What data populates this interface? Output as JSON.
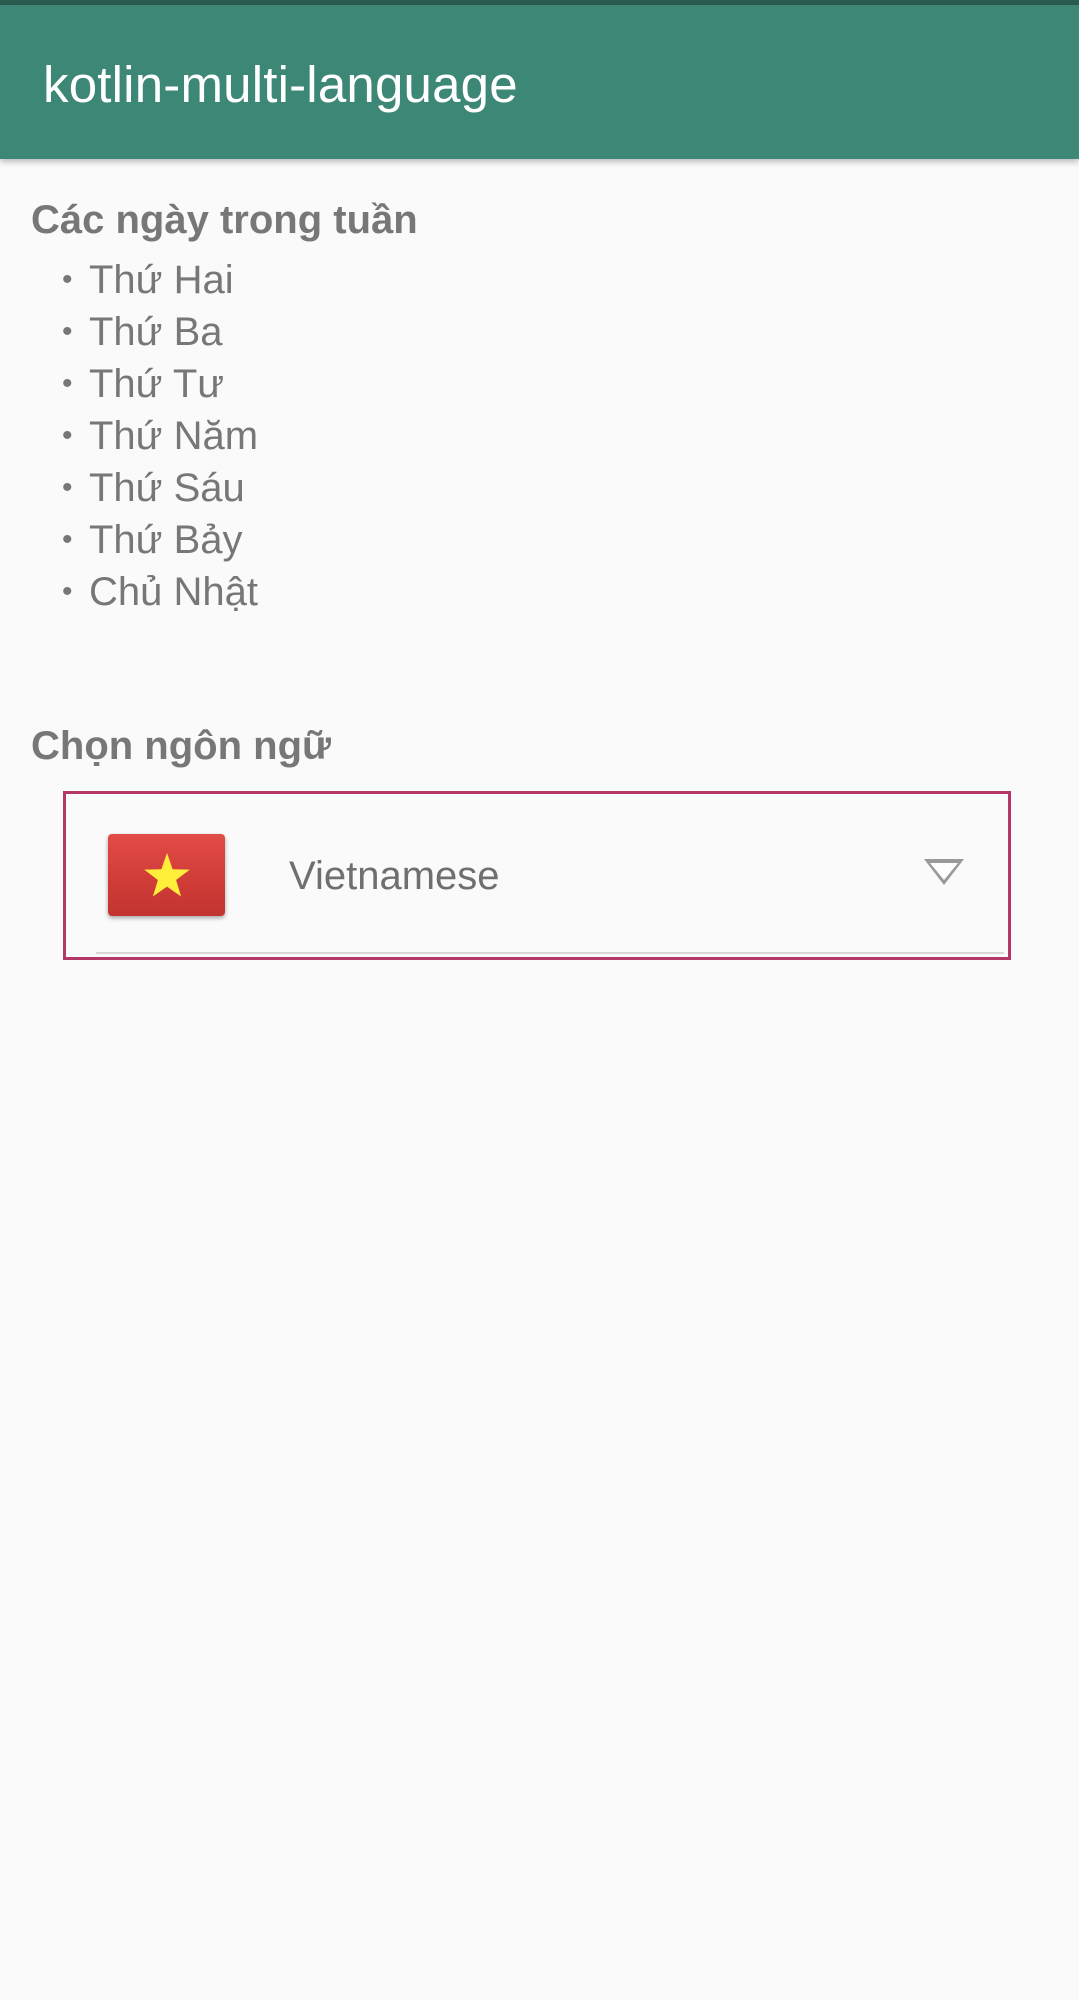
{
  "app_bar": {
    "title": "kotlin-multi-language",
    "color": "#3d8776"
  },
  "days_section": {
    "title": "Các ngày trong tuần",
    "days": [
      "Thứ Hai",
      "Thứ Ba",
      "Thứ Tư",
      "Thứ Năm",
      "Thứ Sáu",
      "Thứ Bảy",
      "Chủ Nhật"
    ]
  },
  "language_section": {
    "title": "Chọn ngôn ngữ",
    "spinner": {
      "selected_label": "Vietnamese",
      "flag_icon": "vietnam-flag-icon",
      "arrow_icon": "dropdown-triangle-icon",
      "border_color": "#b5376a"
    }
  },
  "bullet_glyph": "•"
}
